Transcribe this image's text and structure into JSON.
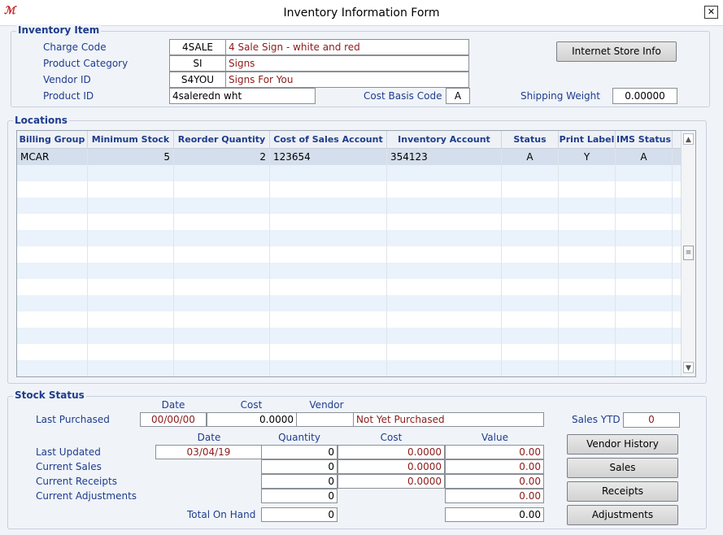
{
  "window": {
    "title": "Inventory Information Form",
    "close_glyph": "✕",
    "logo_glyph": "ℳ"
  },
  "inventory_item": {
    "legend": "Inventory Item",
    "charge_code_label": "Charge Code",
    "charge_code": "4SALE",
    "charge_code_desc": "4 Sale Sign - white and red",
    "product_category_label": "Product Category",
    "product_category": "SI",
    "product_category_desc": "Signs",
    "vendor_id_label": "Vendor ID",
    "vendor_id": "S4YOU",
    "vendor_desc": "Signs For You",
    "product_id_label": "Product ID",
    "product_id": "4saleredn wht",
    "cost_basis_label": "Cost Basis Code",
    "cost_basis": "A",
    "shipping_weight_label": "Shipping Weight",
    "shipping_weight": "0.00000",
    "internet_store_button": "Internet Store Info"
  },
  "locations": {
    "legend": "Locations",
    "columns": [
      "Billing Group",
      "Minimum Stock",
      "Reorder Quantity",
      "Cost of Sales Account",
      "Inventory Account",
      "Status",
      "Print Label",
      "IMS Status"
    ],
    "rows": [
      [
        "MCAR",
        "5",
        "2",
        "123654",
        "354123",
        "A",
        "Y",
        "A"
      ]
    ],
    "scroll_up": "▲",
    "scroll_down": "▼",
    "scroll_thumb": "≡"
  },
  "stock_status": {
    "legend": "Stock Status",
    "top_headers": {
      "date": "Date",
      "cost": "Cost",
      "vendor": "Vendor"
    },
    "last_purchased_label": "Last Purchased",
    "last_purchased_date": "00/00/00",
    "last_purchased_cost": "0.0000",
    "last_purchased_vendor": "",
    "last_purchased_vendor_desc": "Not Yet Purchased",
    "sales_ytd_label": "Sales YTD",
    "sales_ytd": "0",
    "headers": {
      "date": "Date",
      "quantity": "Quantity",
      "cost": "Cost",
      "value": "Value"
    },
    "last_updated_label": "Last Updated",
    "last_updated_date": "03/04/19",
    "last_updated_qty": "0",
    "last_updated_cost": "0.0000",
    "last_updated_value": "0.00",
    "current_sales_label": "Current Sales",
    "current_sales_qty": "0",
    "current_sales_cost": "0.0000",
    "current_sales_value": "0.00",
    "current_receipts_label": "Current Receipts",
    "current_receipts_qty": "0",
    "current_receipts_cost": "0.0000",
    "current_receipts_value": "0.00",
    "current_adjustments_label": "Current Adjustments",
    "current_adjustments_qty": "0",
    "current_adjustments_value": "0.00",
    "total_on_hand_label": "Total On Hand",
    "total_on_hand_qty": "0",
    "total_on_hand_value": "0.00",
    "buttons": {
      "vendor_history": "Vendor History",
      "sales": "Sales",
      "receipts": "Receipts",
      "adjustments": "Adjustments"
    }
  }
}
